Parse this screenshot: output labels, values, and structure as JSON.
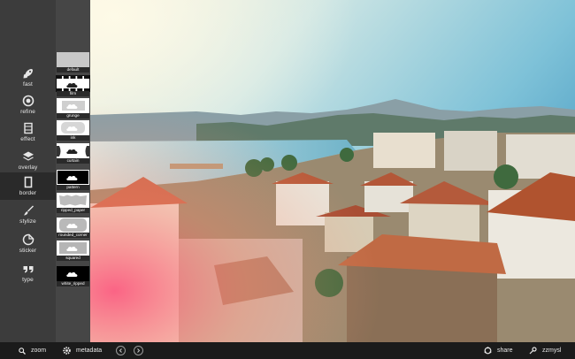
{
  "sidebar": {
    "tools": [
      {
        "label": "fast",
        "icon": "rocket-icon"
      },
      {
        "label": "refine",
        "icon": "aperture-icon"
      },
      {
        "label": "effect",
        "icon": "film-icon"
      },
      {
        "label": "overlay",
        "icon": "layers-icon"
      },
      {
        "label": "border",
        "icon": "border-frame-icon",
        "active": true
      },
      {
        "label": "stylize",
        "icon": "brush-icon"
      },
      {
        "label": "sticker",
        "icon": "sticker-icon"
      },
      {
        "label": "type",
        "icon": "quote-icon"
      }
    ]
  },
  "borders": [
    {
      "label": "default"
    },
    {
      "label": "film"
    },
    {
      "label": "grunge"
    },
    {
      "label": "ink"
    },
    {
      "label": "curtain"
    },
    {
      "label": "pattern"
    },
    {
      "label": "ripped_paper"
    },
    {
      "label": "rounded_corner"
    },
    {
      "label": "squared"
    },
    {
      "label": "white_ripped"
    }
  ],
  "bottombar": {
    "zoom_label": "zoom",
    "metadata_label": "metadata",
    "share_label": "share",
    "user_label": "zzmysl"
  },
  "colors": {
    "sidebar_bg": "#3c3c3c",
    "strip_bg": "#464646",
    "bottombar_bg": "#1b1b1b"
  }
}
